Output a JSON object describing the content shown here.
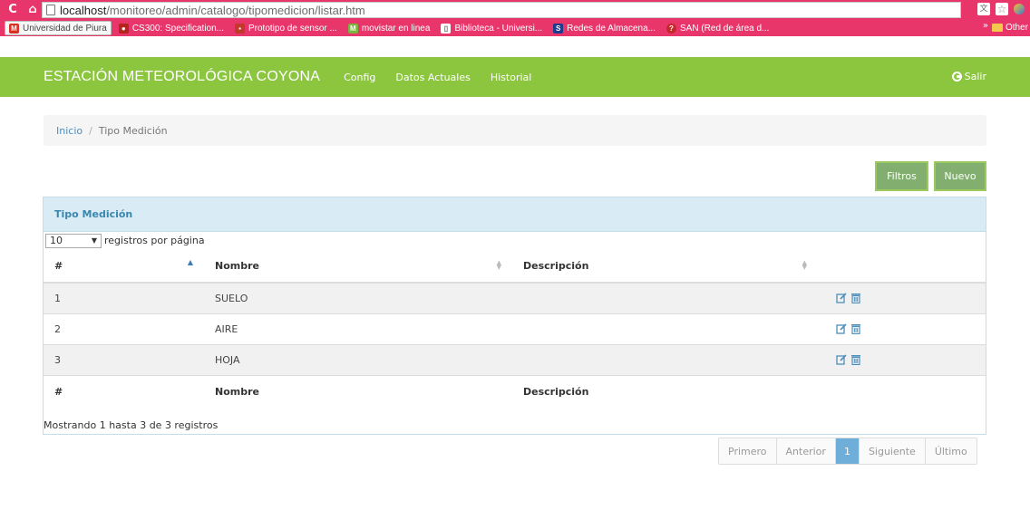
{
  "browser": {
    "url_host": "localhost",
    "url_path": "/monitoreo/admin/catalogo/tipomedicion/listar.htm",
    "bookmarks": [
      {
        "label": "Universidad de Piura",
        "icon": "gmail-icon"
      },
      {
        "label": "CS300: Specification...",
        "icon": "bookmark-icon"
      },
      {
        "label": "Prototipo de sensor ...",
        "icon": "bookmark-icon"
      },
      {
        "label": "movistar en linea",
        "icon": "movistar-icon"
      },
      {
        "label": "Biblioteca - Universi...",
        "icon": "page-icon"
      },
      {
        "label": "Redes de Almacena...",
        "icon": "bookmark-icon"
      },
      {
        "label": "SAN (Red de área d...",
        "icon": "help-icon"
      }
    ],
    "more": "»",
    "other": "Other"
  },
  "navbar": {
    "brand": "ESTACIÓN METEOROLÓGICA COYONA",
    "links": [
      "Config",
      "Datos Actuales",
      "Historial"
    ],
    "logout": "Salir"
  },
  "breadcrumb": {
    "home": "Inicio",
    "separator": "/",
    "current": "Tipo Medición"
  },
  "actions": {
    "filtros": "Filtros",
    "nuevo": "Nuevo"
  },
  "widget": {
    "title": "Tipo Medición",
    "page_length": "10",
    "page_length_label": "registros por página",
    "columns": [
      "#",
      "Nombre",
      "Descripción",
      ""
    ],
    "rows": [
      {
        "id": "1",
        "nombre": "SUELO",
        "descripcion": ""
      },
      {
        "id": "2",
        "nombre": "AIRE",
        "descripcion": ""
      },
      {
        "id": "3",
        "nombre": "HOJA",
        "descripcion": ""
      }
    ],
    "info": "Mostrando 1 hasta 3 de 3 registros"
  },
  "pagination": {
    "first": "Primero",
    "prev": "Anterior",
    "current": "1",
    "next": "Siguiente",
    "last": "Último"
  },
  "colors": {
    "navbar": "#8cc63f",
    "browser_chrome": "#e8366a",
    "link": "#4c8fbd",
    "btn": "#82af6f",
    "widget_header": "#d9ebf5",
    "action_icon": "#4c8fbd"
  }
}
